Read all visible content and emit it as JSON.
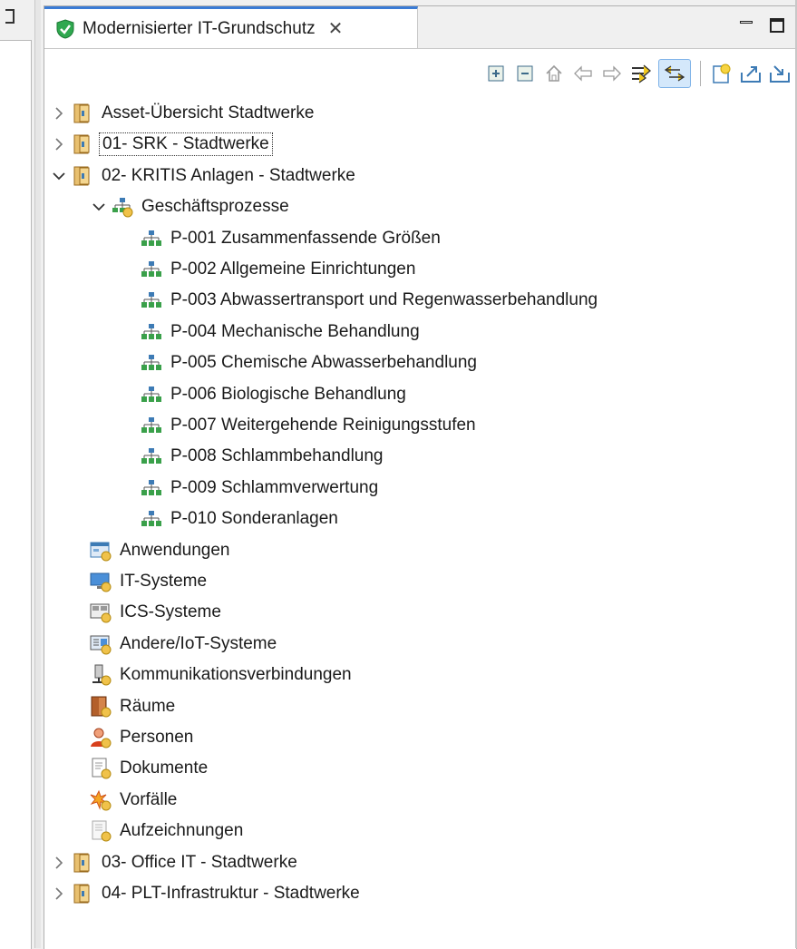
{
  "tab": {
    "title": "Modernisierter IT-Grundschutz",
    "close_glyph": "✕"
  },
  "toolbar": {
    "buttons": [
      "expand-all-icon",
      "collapse-all-icon",
      "home-icon",
      "back-icon",
      "forward-icon",
      "filter-icon",
      "link-with-editor-icon",
      "new-object-icon",
      "export-icon",
      "import-icon"
    ]
  },
  "tree": {
    "items": [
      {
        "label": "Asset-Übersicht Stadtwerke",
        "level": 0,
        "state": "collapsed",
        "icon": "folder-icon"
      },
      {
        "label": "01- SRK - Stadtwerke",
        "level": 0,
        "state": "collapsed",
        "icon": "folder-icon"
      },
      {
        "label": "02- KRITIS Anlagen - Stadtwerke",
        "level": 0,
        "state": "expanded",
        "icon": "folder-icon"
      },
      {
        "label": "Geschäftsprozesse",
        "level": 1,
        "state": "expanded",
        "icon": "process-group-icon"
      },
      {
        "label": "P-001 Zusammenfassende Größen",
        "level": 2,
        "icon": "process-icon"
      },
      {
        "label": "P-002 Allgemeine Einrichtungen",
        "level": 2,
        "icon": "process-icon"
      },
      {
        "label": "P-003 Abwassertransport und Regenwasserbehandlung",
        "level": 2,
        "icon": "process-icon"
      },
      {
        "label": "P-004 Mechanische Behandlung",
        "level": 2,
        "icon": "process-icon"
      },
      {
        "label": "P-005 Chemische Abwasserbehandlung",
        "level": 2,
        "icon": "process-icon"
      },
      {
        "label": "P-006 Biologische Behandlung",
        "level": 2,
        "icon": "process-icon"
      },
      {
        "label": "P-007 Weitergehende Reinigungsstufen",
        "level": 2,
        "icon": "process-icon"
      },
      {
        "label": "P-008 Schlammbehandlung",
        "level": 2,
        "icon": "process-icon"
      },
      {
        "label": "P-009 Schlammverwertung",
        "level": 2,
        "icon": "process-icon"
      },
      {
        "label": "P-010 Sonderanlagen",
        "level": 2,
        "icon": "process-icon"
      },
      {
        "label": "Anwendungen",
        "level": 1,
        "icon": "application-icon"
      },
      {
        "label": "IT-Systeme",
        "level": 1,
        "icon": "it-system-icon"
      },
      {
        "label": "ICS-Systeme",
        "level": 1,
        "icon": "ics-system-icon"
      },
      {
        "label": "Andere/IoT-Systeme",
        "level": 1,
        "icon": "iot-system-icon"
      },
      {
        "label": "Kommunikationsverbindungen",
        "level": 1,
        "icon": "network-icon"
      },
      {
        "label": "Räume",
        "level": 1,
        "icon": "room-icon"
      },
      {
        "label": "Personen",
        "level": 1,
        "icon": "person-icon"
      },
      {
        "label": "Dokumente",
        "level": 1,
        "icon": "document-icon"
      },
      {
        "label": "Vorfälle",
        "level": 1,
        "icon": "incident-icon"
      },
      {
        "label": "Aufzeichnungen",
        "level": 1,
        "icon": "record-icon"
      },
      {
        "label": "03- Office IT - Stadtwerke",
        "level": 0,
        "state": "collapsed",
        "icon": "folder-icon"
      },
      {
        "label": "04- PLT-Infrastruktur - Stadtwerke",
        "level": 0,
        "state": "collapsed",
        "icon": "folder-icon"
      }
    ]
  }
}
